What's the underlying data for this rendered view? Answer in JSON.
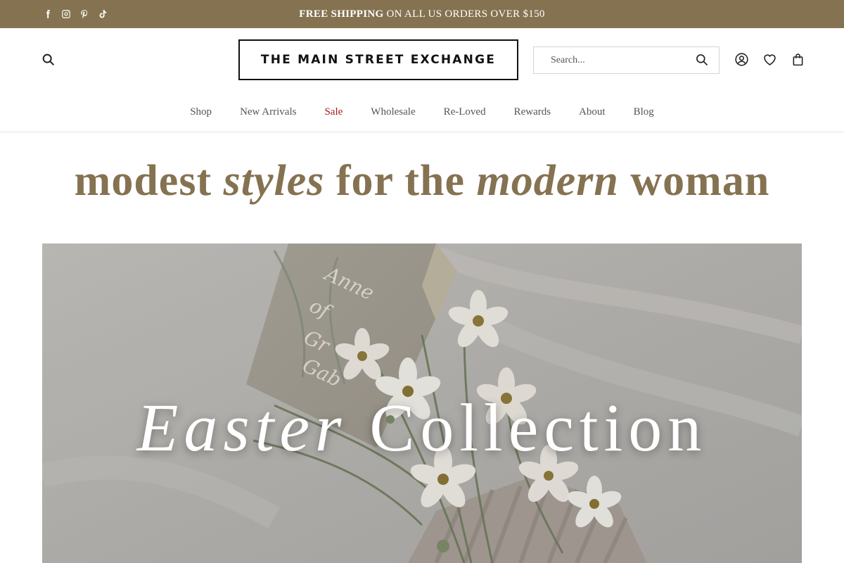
{
  "announcement": {
    "bold": "FREE SHIPPING",
    "rest": " ON ALL US ORDERS OVER $150",
    "background": "#857251"
  },
  "social": [
    "facebook-icon",
    "instagram-icon",
    "pinterest-icon",
    "tiktok-icon"
  ],
  "header": {
    "logo": "THE MAIN STREET EXCHANGE",
    "search_placeholder": "Search...",
    "icons": [
      "account-icon",
      "wishlist-heart-icon",
      "cart-bag-icon"
    ]
  },
  "nav": {
    "items": [
      {
        "label": "Shop"
      },
      {
        "label": "New Arrivals"
      },
      {
        "label": "Sale",
        "color": "#a3191f"
      },
      {
        "label": "Wholesale"
      },
      {
        "label": "Re-Loved"
      },
      {
        "label": "Rewards"
      },
      {
        "label": "About"
      },
      {
        "label": "Blog"
      }
    ]
  },
  "tagline": {
    "p1": "modest ",
    "p2": "styles",
    "p3": " for the ",
    "p4": "modern",
    "p5": " woman",
    "color": "#857251"
  },
  "hero": {
    "title_italic": "Easter",
    "title_rest": " Collection",
    "book_text": [
      "Anne",
      "of",
      "Gr",
      "Gab"
    ]
  }
}
